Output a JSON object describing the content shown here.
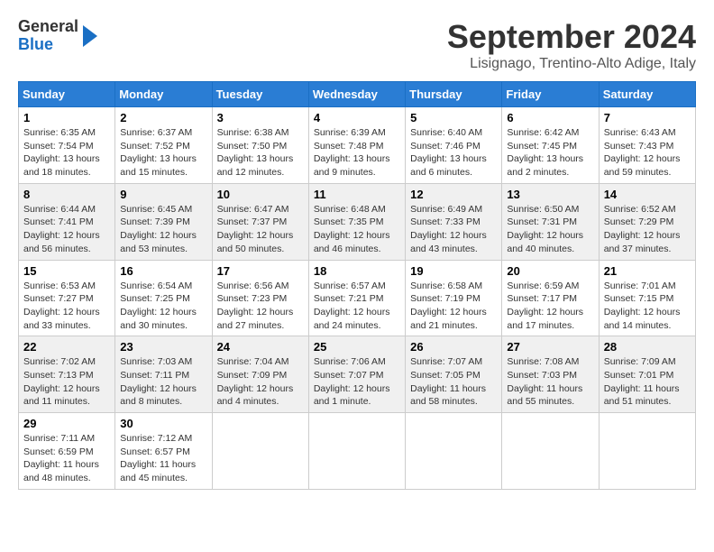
{
  "header": {
    "logo_line1": "General",
    "logo_line2": "Blue",
    "month": "September 2024",
    "location": "Lisignago, Trentino-Alto Adige, Italy"
  },
  "weekdays": [
    "Sunday",
    "Monday",
    "Tuesday",
    "Wednesday",
    "Thursday",
    "Friday",
    "Saturday"
  ],
  "weeks": [
    [
      {
        "day": "1",
        "info": "Sunrise: 6:35 AM\nSunset: 7:54 PM\nDaylight: 13 hours\nand 18 minutes."
      },
      {
        "day": "2",
        "info": "Sunrise: 6:37 AM\nSunset: 7:52 PM\nDaylight: 13 hours\nand 15 minutes."
      },
      {
        "day": "3",
        "info": "Sunrise: 6:38 AM\nSunset: 7:50 PM\nDaylight: 13 hours\nand 12 minutes."
      },
      {
        "day": "4",
        "info": "Sunrise: 6:39 AM\nSunset: 7:48 PM\nDaylight: 13 hours\nand 9 minutes."
      },
      {
        "day": "5",
        "info": "Sunrise: 6:40 AM\nSunset: 7:46 PM\nDaylight: 13 hours\nand 6 minutes."
      },
      {
        "day": "6",
        "info": "Sunrise: 6:42 AM\nSunset: 7:45 PM\nDaylight: 13 hours\nand 2 minutes."
      },
      {
        "day": "7",
        "info": "Sunrise: 6:43 AM\nSunset: 7:43 PM\nDaylight: 12 hours\nand 59 minutes."
      }
    ],
    [
      {
        "day": "8",
        "info": "Sunrise: 6:44 AM\nSunset: 7:41 PM\nDaylight: 12 hours\nand 56 minutes."
      },
      {
        "day": "9",
        "info": "Sunrise: 6:45 AM\nSunset: 7:39 PM\nDaylight: 12 hours\nand 53 minutes."
      },
      {
        "day": "10",
        "info": "Sunrise: 6:47 AM\nSunset: 7:37 PM\nDaylight: 12 hours\nand 50 minutes."
      },
      {
        "day": "11",
        "info": "Sunrise: 6:48 AM\nSunset: 7:35 PM\nDaylight: 12 hours\nand 46 minutes."
      },
      {
        "day": "12",
        "info": "Sunrise: 6:49 AM\nSunset: 7:33 PM\nDaylight: 12 hours\nand 43 minutes."
      },
      {
        "day": "13",
        "info": "Sunrise: 6:50 AM\nSunset: 7:31 PM\nDaylight: 12 hours\nand 40 minutes."
      },
      {
        "day": "14",
        "info": "Sunrise: 6:52 AM\nSunset: 7:29 PM\nDaylight: 12 hours\nand 37 minutes."
      }
    ],
    [
      {
        "day": "15",
        "info": "Sunrise: 6:53 AM\nSunset: 7:27 PM\nDaylight: 12 hours\nand 33 minutes."
      },
      {
        "day": "16",
        "info": "Sunrise: 6:54 AM\nSunset: 7:25 PM\nDaylight: 12 hours\nand 30 minutes."
      },
      {
        "day": "17",
        "info": "Sunrise: 6:56 AM\nSunset: 7:23 PM\nDaylight: 12 hours\nand 27 minutes."
      },
      {
        "day": "18",
        "info": "Sunrise: 6:57 AM\nSunset: 7:21 PM\nDaylight: 12 hours\nand 24 minutes."
      },
      {
        "day": "19",
        "info": "Sunrise: 6:58 AM\nSunset: 7:19 PM\nDaylight: 12 hours\nand 21 minutes."
      },
      {
        "day": "20",
        "info": "Sunrise: 6:59 AM\nSunset: 7:17 PM\nDaylight: 12 hours\nand 17 minutes."
      },
      {
        "day": "21",
        "info": "Sunrise: 7:01 AM\nSunset: 7:15 PM\nDaylight: 12 hours\nand 14 minutes."
      }
    ],
    [
      {
        "day": "22",
        "info": "Sunrise: 7:02 AM\nSunset: 7:13 PM\nDaylight: 12 hours\nand 11 minutes."
      },
      {
        "day": "23",
        "info": "Sunrise: 7:03 AM\nSunset: 7:11 PM\nDaylight: 12 hours\nand 8 minutes."
      },
      {
        "day": "24",
        "info": "Sunrise: 7:04 AM\nSunset: 7:09 PM\nDaylight: 12 hours\nand 4 minutes."
      },
      {
        "day": "25",
        "info": "Sunrise: 7:06 AM\nSunset: 7:07 PM\nDaylight: 12 hours\nand 1 minute."
      },
      {
        "day": "26",
        "info": "Sunrise: 7:07 AM\nSunset: 7:05 PM\nDaylight: 11 hours\nand 58 minutes."
      },
      {
        "day": "27",
        "info": "Sunrise: 7:08 AM\nSunset: 7:03 PM\nDaylight: 11 hours\nand 55 minutes."
      },
      {
        "day": "28",
        "info": "Sunrise: 7:09 AM\nSunset: 7:01 PM\nDaylight: 11 hours\nand 51 minutes."
      }
    ],
    [
      {
        "day": "29",
        "info": "Sunrise: 7:11 AM\nSunset: 6:59 PM\nDaylight: 11 hours\nand 48 minutes."
      },
      {
        "day": "30",
        "info": "Sunrise: 7:12 AM\nSunset: 6:57 PM\nDaylight: 11 hours\nand 45 minutes."
      },
      {
        "day": "",
        "info": ""
      },
      {
        "day": "",
        "info": ""
      },
      {
        "day": "",
        "info": ""
      },
      {
        "day": "",
        "info": ""
      },
      {
        "day": "",
        "info": ""
      }
    ]
  ]
}
